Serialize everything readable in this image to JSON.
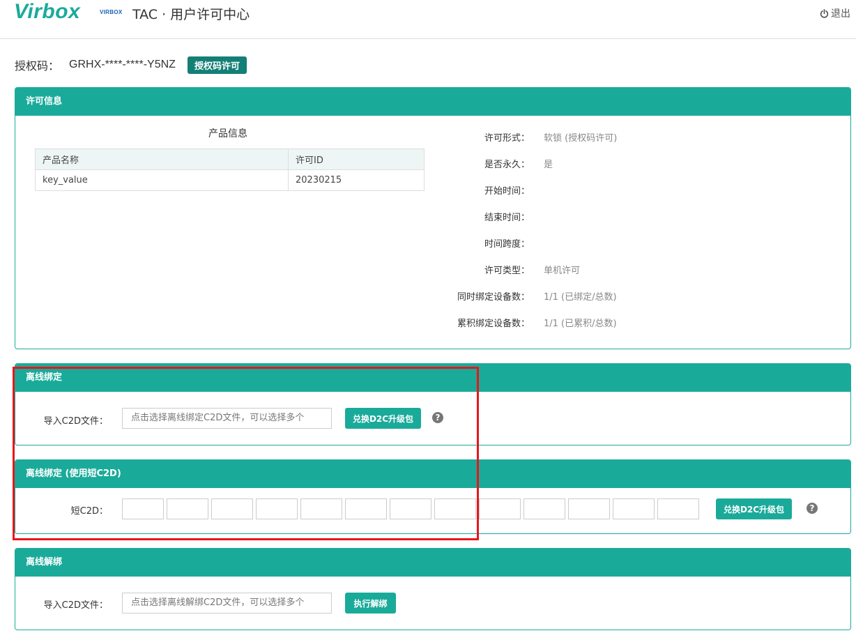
{
  "header": {
    "logo": "Virbox",
    "mini_logo": "VIRBOX",
    "title": "TAC · 用户许可中心",
    "logout_label": "退出"
  },
  "auth": {
    "label": "授权码：",
    "code": "GRHX-****-****-Y5NZ",
    "button": "授权码许可"
  },
  "license_panel": {
    "title": "许可信息",
    "product_title": "产品信息",
    "table_headers": [
      "产品名称",
      "许可ID"
    ],
    "table_rows": [
      [
        "key_value",
        "20230215"
      ]
    ],
    "fields": [
      {
        "label": "许可形式：",
        "value": "软锁 (授权码许可)"
      },
      {
        "label": "是否永久：",
        "value": "是"
      },
      {
        "label": "开始时间：",
        "value": ""
      },
      {
        "label": "结束时间：",
        "value": ""
      },
      {
        "label": "时间跨度：",
        "value": ""
      },
      {
        "label": "许可类型：",
        "value": "单机许可"
      },
      {
        "label": "同时绑定设备数：",
        "value": "1/1 (已绑定/总数)"
      },
      {
        "label": "累积绑定设备数：",
        "value": "1/1 (已累积/总数)"
      }
    ]
  },
  "offline_bind": {
    "title": "离线绑定",
    "label": "导入C2D文件：",
    "placeholder": "点击选择离线绑定C2D文件，可以选择多个",
    "button": "兑换D2C升级包",
    "help": "?"
  },
  "offline_bind_short": {
    "title": "离线绑定 (使用短C2D)",
    "label": "短C2D：",
    "button": "兑换D2C升级包",
    "help": "?"
  },
  "offline_unbind": {
    "title": "离线解绑",
    "label": "导入C2D文件：",
    "placeholder": "点击选择离线解绑C2D文件，可以选择多个",
    "button": "执行解绑"
  }
}
